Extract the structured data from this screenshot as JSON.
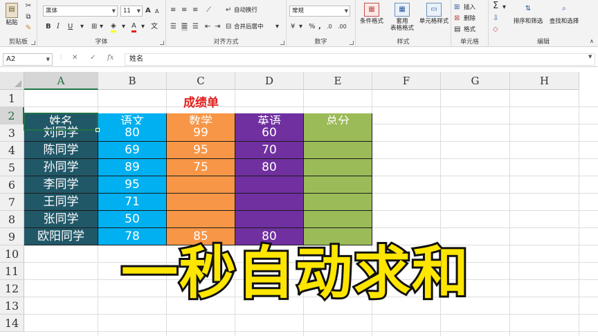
{
  "ribbon": {
    "clipboard": {
      "group_label": "剪贴板",
      "paste_label": "粘贴"
    },
    "font": {
      "group_label": "字体",
      "font_name": "黑体",
      "font_size": "11",
      "bold": "B",
      "italic": "I",
      "underline": "U",
      "grow": "A",
      "shrink": "A"
    },
    "alignment": {
      "group_label": "对齐方式",
      "wrap_label": "自动换行",
      "merge_label": "合并后居中"
    },
    "number": {
      "group_label": "数字",
      "format": "常规",
      "percent": "%",
      "comma": ","
    },
    "styles": {
      "group_label": "样式",
      "conditional_label": "条件格式",
      "table_label_line1": "套用",
      "table_label_line2": "表格格式",
      "cell_styles_label": "单元格样式"
    },
    "cells": {
      "group_label": "单元格",
      "insert_label": "插入",
      "delete_label": "删除",
      "format_label": "格式"
    },
    "editing": {
      "group_label": "编辑",
      "sum_icon": "Σ",
      "sort_label": "排序和筛选",
      "find_label": "查找和选择"
    }
  },
  "formula_bar": {
    "name_box": "A2",
    "fx": "fx",
    "content": "姓名"
  },
  "columns": [
    "A",
    "B",
    "C",
    "D",
    "E",
    "F",
    "G",
    "H"
  ],
  "rows": [
    "1",
    "2",
    "3",
    "4",
    "5",
    "6",
    "7",
    "8",
    "9",
    "10",
    "11",
    "12",
    "13",
    "14"
  ],
  "sheet": {
    "title": "成绩单",
    "headers": {
      "name": "姓名",
      "chinese": "语文",
      "math": "数学",
      "english": "英语",
      "total": "总分"
    },
    "records": [
      {
        "name": "刘同学",
        "chinese": "80",
        "math": "99",
        "english": "60",
        "total": ""
      },
      {
        "name": "陈同学",
        "chinese": "69",
        "math": "95",
        "english": "70",
        "total": ""
      },
      {
        "name": "孙同学",
        "chinese": "89",
        "math": "75",
        "english": "80",
        "total": ""
      },
      {
        "name": "李同学",
        "chinese": "95",
        "math": "",
        "english": "",
        "total": ""
      },
      {
        "name": "王同学",
        "chinese": "71",
        "math": "",
        "english": "",
        "total": ""
      },
      {
        "name": "张同学",
        "chinese": "50",
        "math": "",
        "english": "",
        "total": ""
      },
      {
        "name": "欧阳同学",
        "chinese": "78",
        "math": "85",
        "english": "80",
        "total": ""
      }
    ]
  },
  "overlay_caption": "一秒自动求和",
  "colors": {
    "name_col": "#215868",
    "chinese_col": "#00b0f0",
    "math_col": "#f79646",
    "english_col": "#7030a0",
    "total_col": "#9bbb59",
    "title_text": "#e0201c",
    "caption_fill": "#ffe600",
    "selection": "#217346"
  }
}
